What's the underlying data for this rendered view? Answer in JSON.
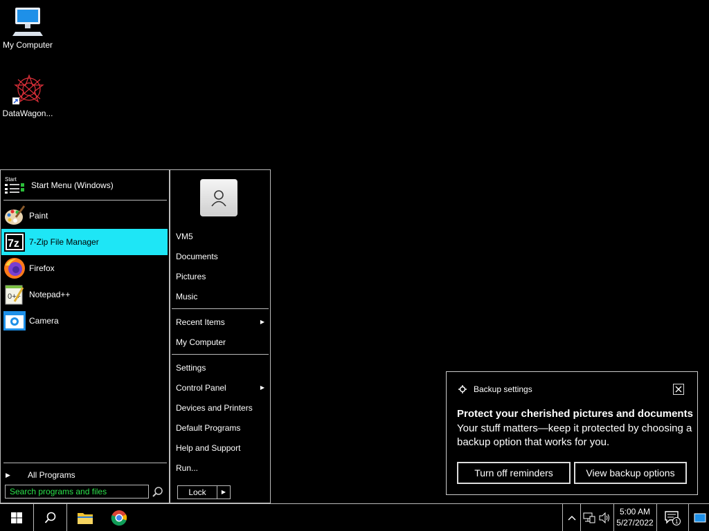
{
  "desktop": {
    "icons": [
      {
        "label": "My Computer",
        "icon": "computer-icon"
      },
      {
        "label": "DataWagon...",
        "icon": "datawagon-icon"
      }
    ]
  },
  "start_menu": {
    "header": {
      "label": "Start Menu (Windows)",
      "logo_text": "Start"
    },
    "pinned": [
      {
        "label": "Paint",
        "icon": "paint-icon"
      },
      {
        "label": "7-Zip File Manager",
        "icon": "7zip-icon",
        "selected": true
      },
      {
        "label": "Firefox",
        "icon": "firefox-icon"
      },
      {
        "label": "Notepad++",
        "icon": "notepadpp-icon"
      },
      {
        "label": "Camera",
        "icon": "camera-icon"
      }
    ],
    "all_programs_label": "All Programs",
    "search_placeholder": "Search programs and files",
    "right": {
      "user_name": "VM5",
      "items1": [
        "Documents",
        "Pictures",
        "Music"
      ],
      "items2": [
        "Recent Items",
        "My Computer"
      ],
      "items3": [
        "Settings",
        "Control Panel",
        "Devices and Printers",
        "Default Programs",
        "Help and Support",
        "Run..."
      ],
      "submenu_items": [
        "Recent Items",
        "Control Panel"
      ]
    },
    "lock_label": "Lock"
  },
  "notification": {
    "app_name": "Backup settings",
    "title": "Protect your cherished pictures and documents",
    "body": "Your stuff matters—keep it protected by choosing a backup option that works for you.",
    "buttons": [
      "Turn off reminders",
      "View backup options"
    ]
  },
  "taskbar": {
    "time": "5:00 AM",
    "date": "5/27/2022",
    "notification_count": "1"
  },
  "colors": {
    "selection": "#1ee6f6",
    "search_text": "#2be34b",
    "background": "#000000"
  }
}
